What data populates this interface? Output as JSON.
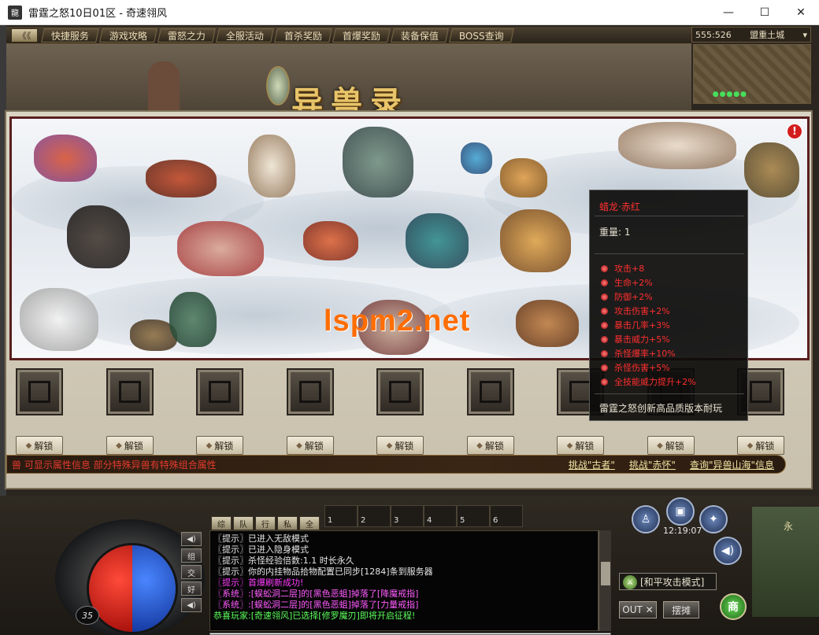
{
  "window": {
    "title": "雷霆之怒10日01区 - 奇速翎风",
    "icon": "龍",
    "buttons": [
      "—",
      "☐",
      "✕"
    ]
  },
  "topbar": {
    "collapse_label": "《《",
    "menu": [
      "快捷服务",
      "游戏攻略",
      "雷怒之力",
      "全服活动",
      "首杀奖励",
      "首爆奖励",
      "装备保值",
      "BOSS查询"
    ]
  },
  "location": {
    "coords": "555:526",
    "map": "盟重土城",
    "dots": "●●●●●"
  },
  "dialog": {
    "title": "异兽录",
    "warning_icon": "!",
    "watermark": "lspm2.net",
    "unlock_label": "解锁",
    "slot_count": 9,
    "info_text": "兽 可显示属性信息  部分特殊异兽有特殊组合属性",
    "links": [
      "挑战\"古者\"",
      "挑战\"赤怀\"",
      "查询\"异兽山海\"信息"
    ]
  },
  "tooltip": {
    "title": "蜡龙·赤红",
    "weight": "重量: 1",
    "attrs": [
      "攻击+8",
      "生命+2%",
      "防御+2%",
      "攻击伤害+2%",
      "暴击几率+3%",
      "暴击威力+5%",
      "杀怪爆率+10%",
      "杀怪伤害+5%",
      "全技能威力提升+2%"
    ],
    "footer": "雷霆之怒创新高品质版本耐玩"
  },
  "hud": {
    "level": "35",
    "side_buttons": [
      "◀)",
      "组",
      "交",
      "好",
      "◀)"
    ],
    "chat_tabs": [
      "综",
      "队",
      "行",
      "私",
      "全"
    ],
    "skill_slots": [
      "1",
      "2",
      "3",
      "4",
      "5",
      "6"
    ],
    "chat_lines": [
      {
        "text": "〖提示〗已进入无敌模式",
        "color": "#e6e6e6"
      },
      {
        "text": "〖提示〗已进入隐身模式",
        "color": "#e6e6e6"
      },
      {
        "text": "〖提示〗杀怪经验倍数:1.1 时长永久",
        "color": "#e6e6e6"
      },
      {
        "text": "〖提示〗你的内挂物品拾物配置已同步[1284]条到服务器",
        "color": "#e6e6e6"
      },
      {
        "text": "〖提示〗首爆刷新成功!",
        "color": "#ff3cff"
      },
      {
        "text": "〖系统〗:[蜈蚣洞二层]的[黑色恶蛆]掉落了[降魔戒指]",
        "color": "#ff5cff"
      },
      {
        "text": "〖系统〗:[蜈蚣洞二层]的[黑色恶蛆]掉落了[力量戒指]",
        "color": "#ff5cff"
      },
      {
        "text": "恭喜玩家:[奇速翎风]已选择[修罗魔刃]即将开启征程!",
        "color": "#5cff5c"
      }
    ],
    "clock": "12:19:07",
    "attack_mode": "[和平攻击模式]",
    "out_label": "OUT ✕",
    "stall_label": "摆摊",
    "shop_label": "商",
    "side_label": "永"
  }
}
